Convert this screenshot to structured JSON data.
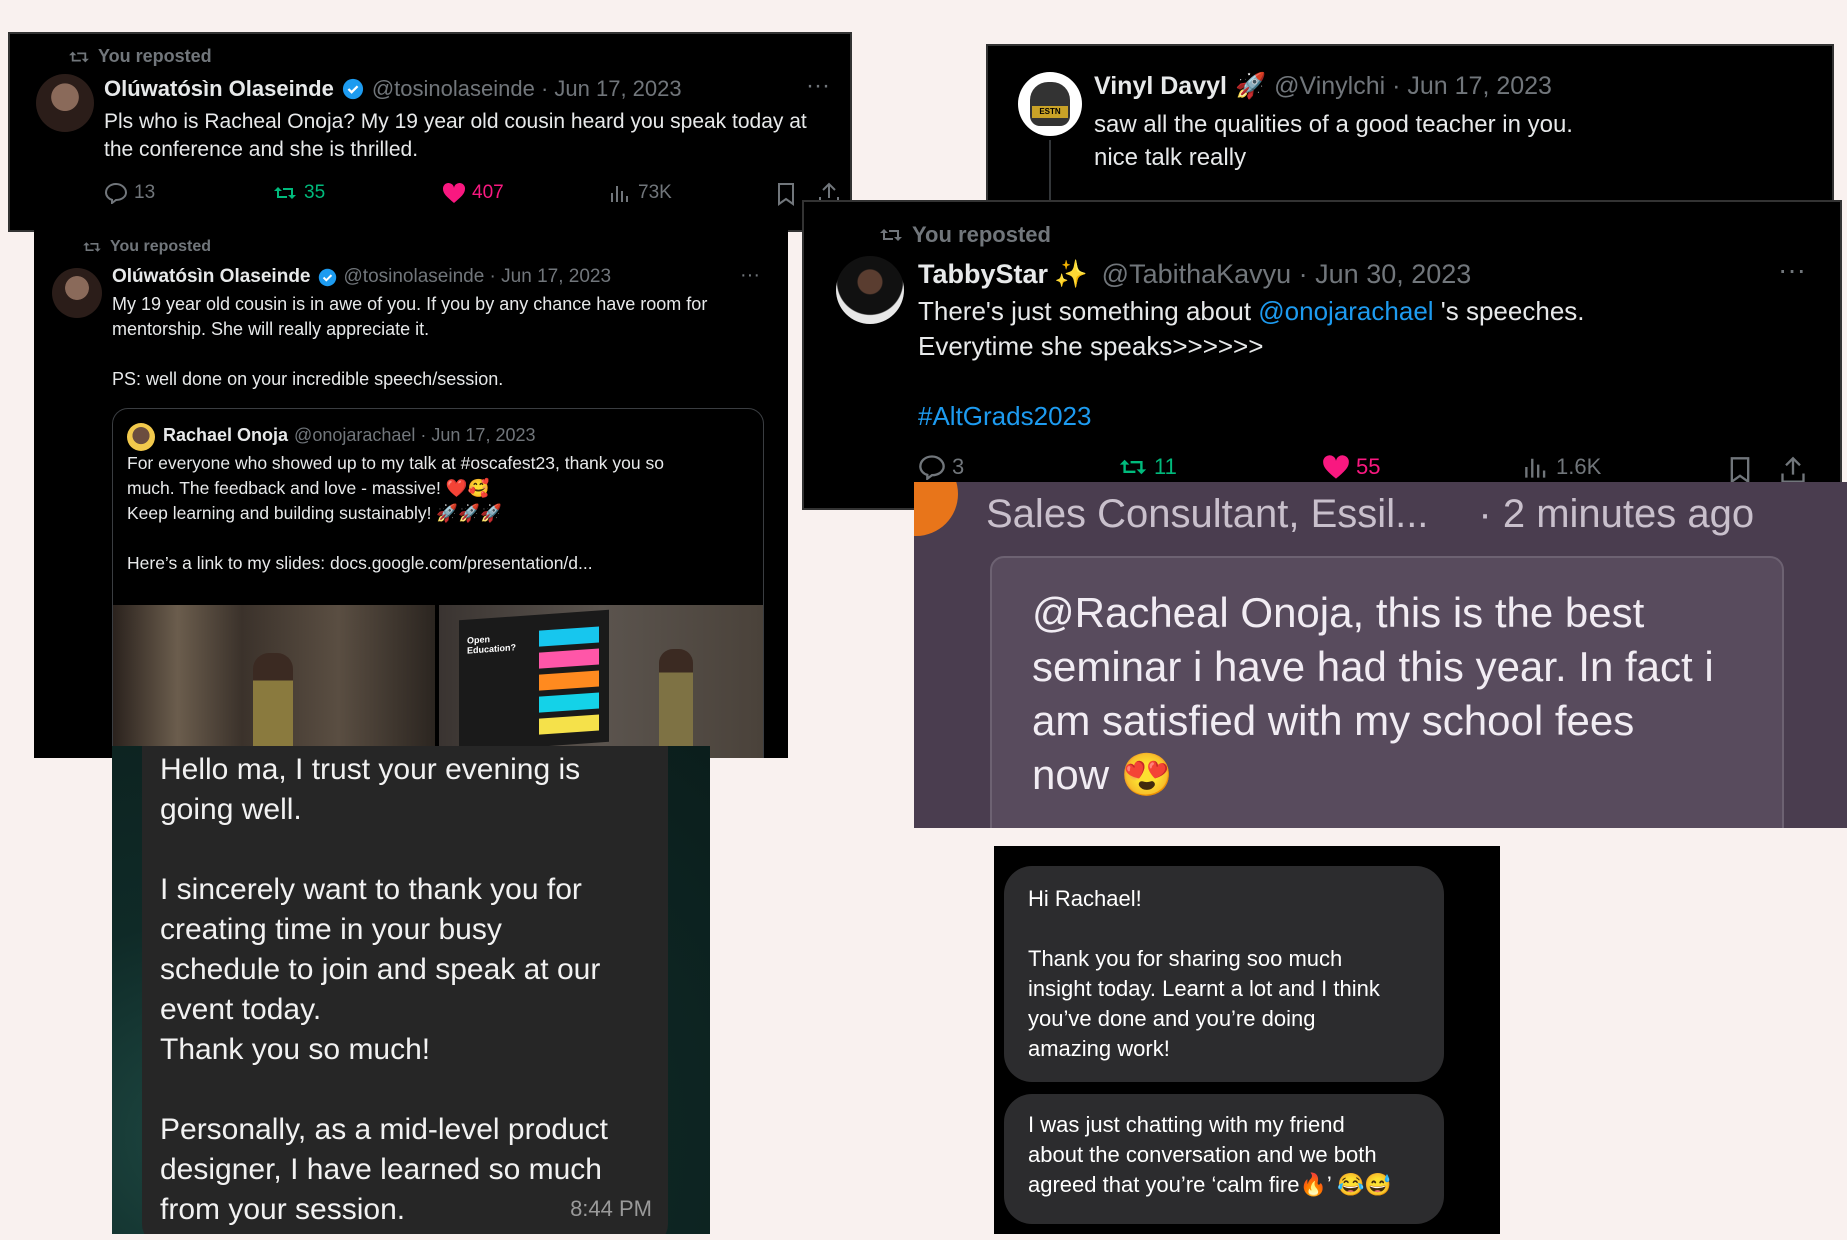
{
  "tweet1": {
    "reposted": "You reposted",
    "name": "Olúwatósìn Olaseinde",
    "meta": "@tosinolaseinde · Jun 17, 2023",
    "line1": "Pls who is Racheal Onoja? My 19 year old cousin heard you speak today at",
    "line2": "the conference and she is thrilled.",
    "replies": "13",
    "reposts": "35",
    "likes": "407",
    "views": "73K"
  },
  "tweet2": {
    "reposted": "You reposted",
    "name": "Olúwatósìn Olaseinde",
    "meta": "@tosinolaseinde · Jun 17, 2023",
    "line1": "My 19 year old cousin is in awe of you. If you by any chance have room for",
    "line2": "mentorship. She will really appreciate it.",
    "line3": "PS: well done on your incredible speech/session.",
    "quote": {
      "name": "Rachael Onoja",
      "meta": "@onojarachael · Jun 17, 2023",
      "line1": "For everyone who showed up to my talk at #oscafest23, thank you so",
      "line2": "much. The feedback and love - massive! ❤️🥰",
      "line3": "Keep learning and building sustainably! 🚀🚀🚀",
      "line4": "Here’s a link to my slides: docs.google.com/presentation/d...",
      "slide_title": "Open Education?"
    }
  },
  "tweet3": {
    "name": "Vinyl Davyl",
    "name_emoji": "🚀",
    "meta": "@Vinylchi · Jun 17, 2023",
    "line1": "saw all the qualities of a good teacher in you.",
    "line2": "nice talk really",
    "avatar_badge": "ESTN"
  },
  "tweet4": {
    "reposted": "You reposted",
    "name": "TabbyStar",
    "name_emoji": "✨",
    "meta": "@TabithaKavyu · Jun 30, 2023",
    "line1_pre": "There's just something about ",
    "mention": "@onojarachael",
    "line1_post": " 's speeches.",
    "line2": "Everytime she speaks>>>>>>",
    "hashtag": "#AltGrads2023",
    "replies": "3",
    "reposts": "11",
    "likes": "55",
    "views": "1.6K"
  },
  "comment": {
    "header_left": "Sales Consultant, Essil...",
    "header_right": "· 2 minutes ago",
    "line1": "@Racheal Onoja, this is the best",
    "line2": "seminar i have had this year. In fact i",
    "line3": "am satisfied with my school fees",
    "line4": "now 😍"
  },
  "message1": {
    "lines": [
      "Hello ma, I trust your evening is",
      "going well.",
      "",
      "I sincerely want to thank you for",
      "creating time in your busy",
      "schedule to join and speak at our",
      "event today.",
      "Thank you so much!",
      "",
      "Personally, as a mid-level product",
      "designer, I have learned so much",
      "from your session."
    ],
    "time": "8:44 PM"
  },
  "message2": {
    "b1": [
      "Hi Rachael!",
      "",
      "Thank you for sharing soo much",
      "insight today. Learnt a lot and I think",
      "you’ve done and you’re doing",
      "amazing work!"
    ],
    "b2": [
      "I was just chatting with my friend",
      "about the conversation and we both",
      "agreed that you’re ‘calm fire🔥’ 😂😅"
    ]
  },
  "colors": {
    "background": "#f9f1ef",
    "x_green": "#00ba7c",
    "x_pink": "#f91880",
    "x_blue": "#1d9bf0",
    "comment_bg": "#4a3d4f"
  }
}
